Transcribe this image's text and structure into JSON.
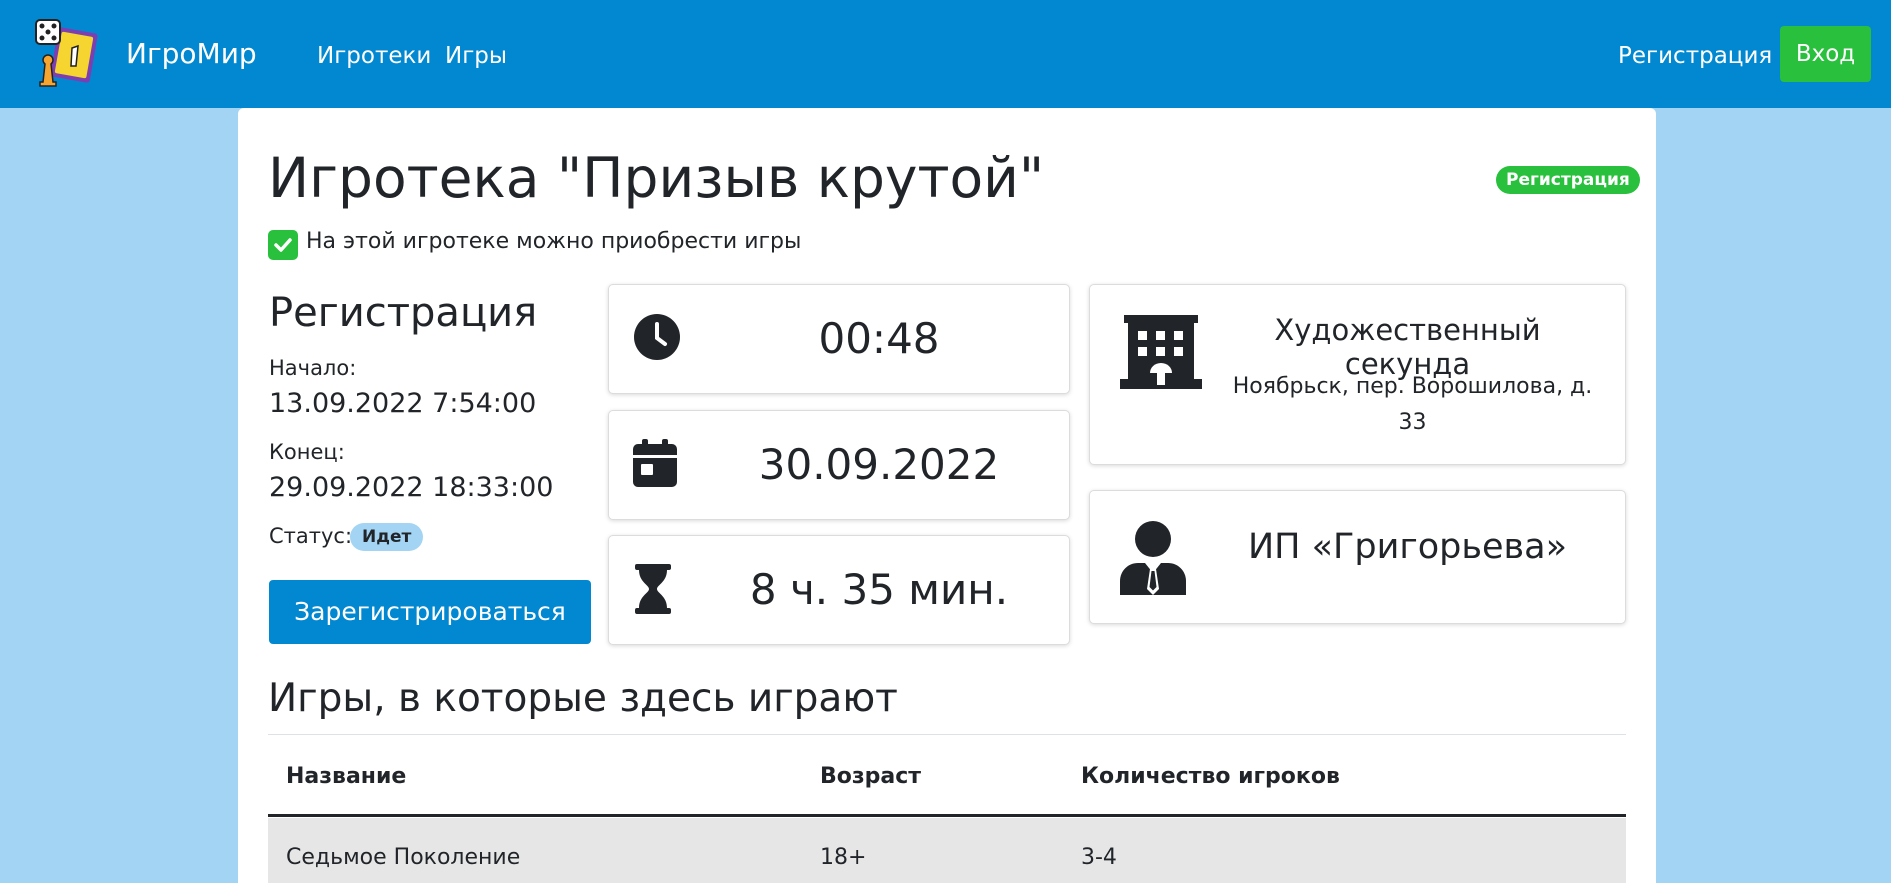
{
  "navbar": {
    "brand": "ИгроМир",
    "links": [
      "Игротеки",
      "Игры"
    ],
    "register_label": "Регистрация",
    "login_label": "Вход",
    "color": "#0288d1",
    "login_color": "#28c03c"
  },
  "event": {
    "title": "Игротека \"Призыв крутой\"",
    "stage_badge": "Регистрация",
    "buy_note": "На этой игротеке можно приобрести игры"
  },
  "registration": {
    "heading": "Регистрация",
    "start_label": "Начало:",
    "start_value": "13.09.2022 7:54:00",
    "end_label": "Конец:",
    "end_value": "29.09.2022 18:33:00",
    "status_label": "Статус:",
    "status_value": "Идет",
    "button_label": "Зарегистрироваться"
  },
  "details": {
    "time": "00:48",
    "date": "30.09.2022",
    "duration": "8 ч. 35 мин.",
    "venue_name": "Художественный секунда",
    "venue_address": "Ноябрьск, пер. Ворошилова, д. 33",
    "organizer": "ИП «Григорьева»"
  },
  "games": {
    "heading": "Игры, в которые здесь играют",
    "columns": [
      "Название",
      "Возраст",
      "Количество игроков"
    ],
    "rows": [
      [
        "Седьмое Поколение",
        "18+",
        "3-4"
      ]
    ]
  },
  "icons": {
    "logo": "logo-icon",
    "check": "check-icon",
    "time": "clock-icon",
    "date": "calendar-icon",
    "duration": "hourglass-icon",
    "venue": "building-icon",
    "organizer": "user-tie-icon"
  }
}
